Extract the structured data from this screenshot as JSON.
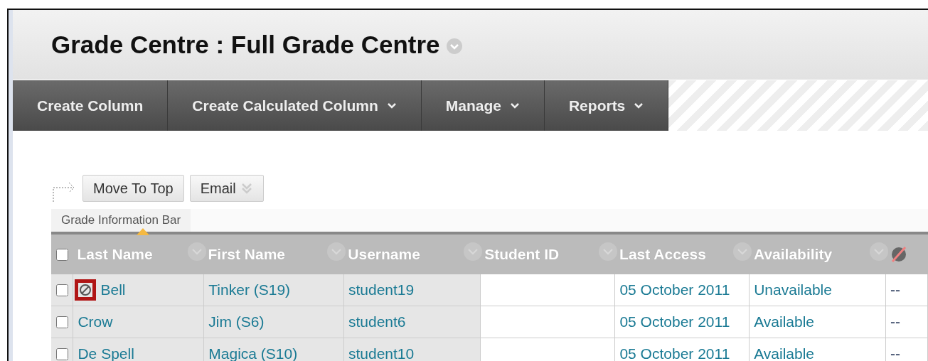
{
  "page_title": "Grade Centre : Full Grade Centre",
  "action_bar": [
    {
      "label": "Create Column",
      "has_menu": false
    },
    {
      "label": "Create Calculated Column",
      "has_menu": true
    },
    {
      "label": "Manage",
      "has_menu": true
    },
    {
      "label": "Reports",
      "has_menu": true
    }
  ],
  "buttons": [
    {
      "label": "Move To Top",
      "has_menu": false
    },
    {
      "label": "Email",
      "has_menu": true
    }
  ],
  "info_bar": {
    "label": "Grade Information Bar"
  },
  "table": {
    "select_all_checked": false,
    "columns": [
      {
        "label": "Last Name",
        "sorted": true,
        "kind": "text"
      },
      {
        "label": "First Name",
        "sorted": false,
        "kind": "text"
      },
      {
        "label": "Username",
        "sorted": false,
        "kind": "text"
      },
      {
        "label": "Student ID",
        "sorted": false,
        "kind": "text"
      },
      {
        "label": "Last Access",
        "sorted": false,
        "kind": "text"
      },
      {
        "label": "Availability",
        "sorted": false,
        "kind": "text"
      },
      {
        "kind": "hidden-icon",
        "sorted": false
      }
    ],
    "rows": [
      {
        "checked": false,
        "unavailable_icon": true,
        "highlighted": true,
        "cells": [
          "Bell",
          "Tinker (S19)",
          "student19",
          "",
          "05 October 2011",
          "Unavailable",
          "--"
        ]
      },
      {
        "checked": false,
        "unavailable_icon": false,
        "highlighted": false,
        "cells": [
          "Crow",
          "Jim (S6)",
          "student6",
          "",
          "05 October 2011",
          "Available",
          "--"
        ]
      },
      {
        "checked": false,
        "unavailable_icon": false,
        "highlighted": false,
        "cells": [
          "De Spell",
          "Magica (S10)",
          "student10",
          "",
          "05 October 2011",
          "Available",
          "--"
        ]
      }
    ]
  }
}
